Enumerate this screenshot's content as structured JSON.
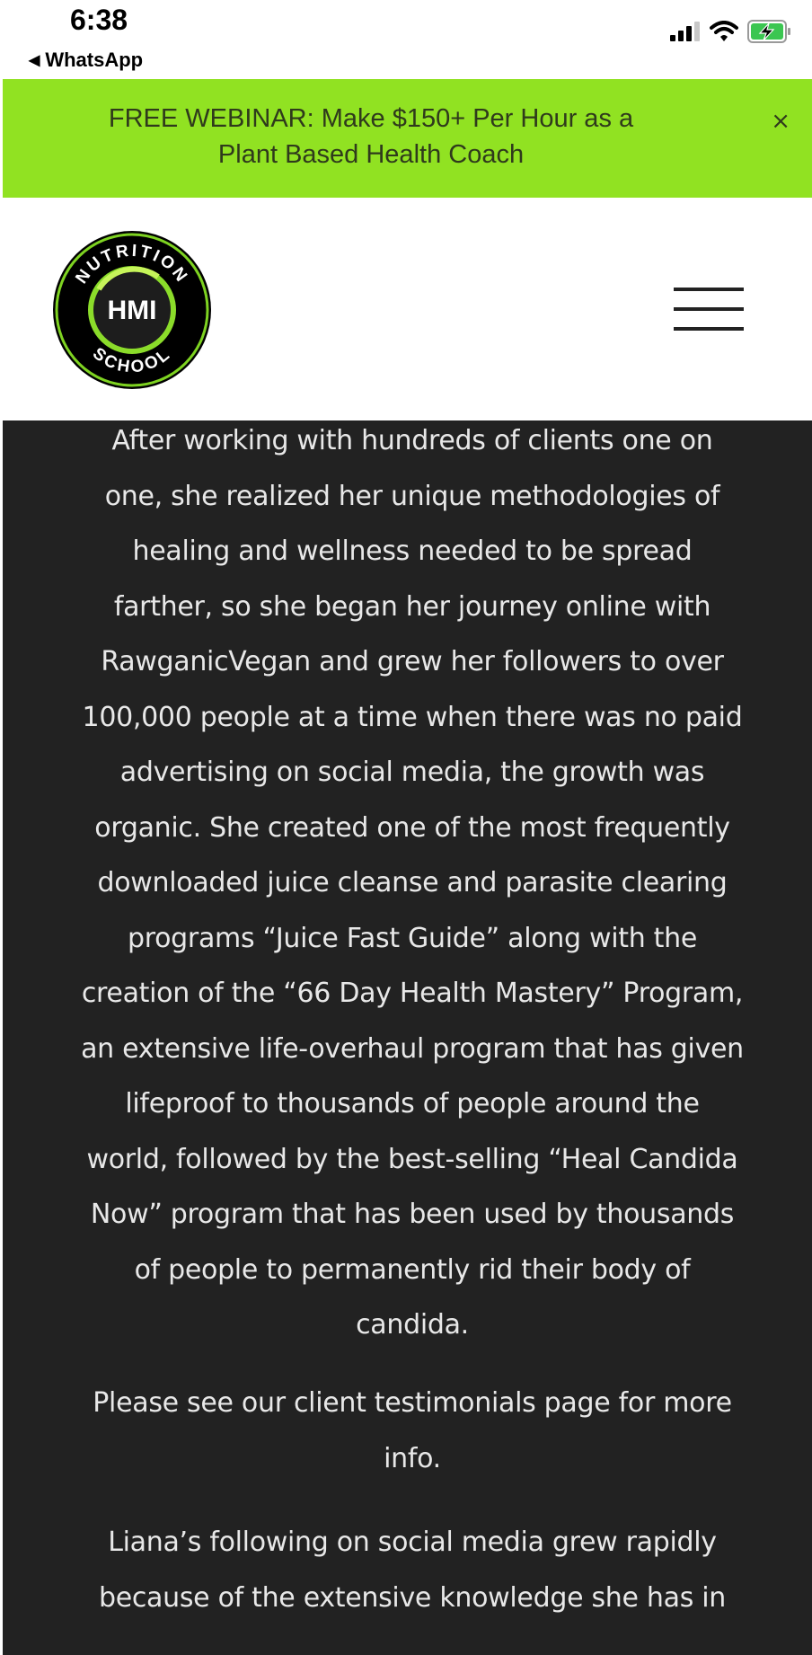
{
  "status_bar": {
    "time": "6:38",
    "back_app": "WhatsApp",
    "icons": [
      "signal-icon",
      "wifi-icon",
      "battery-charging-icon"
    ]
  },
  "promo": {
    "text": "FREE WEBINAR: Make $150+ Per Hour as a\nPlant Based Health Coach",
    "close_label": "×",
    "background_color": "#91e222"
  },
  "header": {
    "logo": {
      "top_text": "NUTRITION",
      "center_text": "HMI",
      "bottom_text": "SCHOOL"
    },
    "menu_icon": "hamburger-menu-icon"
  },
  "content": {
    "background_color": "#222222",
    "paragraphs": [
      "After working with hundreds of clients one on\none, she realized her unique methodologies of\nhealing and wellness needed to be spread\nfarther, so she began her journey online with\nRawganicVegan and grew her followers to over\n100,000 people at a time when there was no paid\nadvertising on social media, the growth was\norganic. She created one of the most frequently\ndownloaded juice cleanse and parasite clearing\nprograms “Juice Fast Guide” along with the\ncreation of the “66 Day Health Mastery” Program,\nan extensive life-overhaul program that has given\nlifeproof to thousands of people around the\nworld, followed by the best-selling “Heal Candida\nNow” program that has been used by thousands\nof people to permanently rid their body of\ncandida.",
      "Please see our client testimonials page for more\ninfo.",
      "Liana’s following on social media grew rapidly\nbecause of the extensive  knowledge she has in"
    ]
  }
}
